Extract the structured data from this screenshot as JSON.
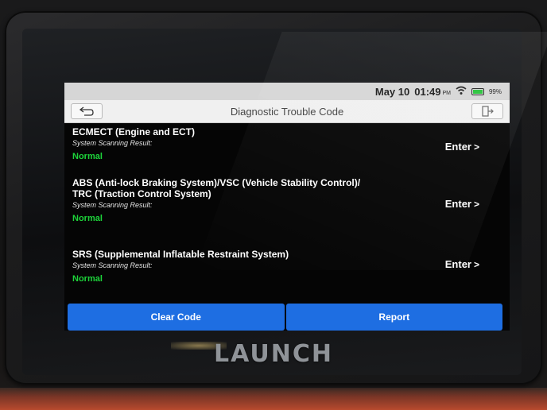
{
  "status_bar": {
    "date": "May 10",
    "time": "01:49",
    "ampm": "PM",
    "battery": "99%"
  },
  "header": {
    "title": "Diagnostic Trouble Code",
    "back_icon": "back-arrow-icon",
    "exit_icon": "exit-icon"
  },
  "systems": [
    {
      "name": "ECMECT (Engine and ECT)",
      "result_label": "System Scanning Result:",
      "result": "Normal",
      "action": "Enter"
    },
    {
      "name": "ABS (Anti-lock Braking System)/VSC (Vehicle Stability Control)/\nTRC (Traction Control System)",
      "result_label": "System Scanning Result:",
      "result": "Normal",
      "action": "Enter"
    },
    {
      "name": "SRS (Supplemental Inflatable Restraint System)",
      "result_label": "System Scanning Result:",
      "result": "Normal",
      "action": "Enter"
    }
  ],
  "footer": {
    "clear_code": "Clear Code",
    "report": "Report"
  },
  "device": {
    "brand": "LAUNCH"
  },
  "colors": {
    "accent_blue": "#1e6ee2",
    "normal_green": "#1dd43a",
    "status_bar_bg": "#d6d6d6"
  }
}
